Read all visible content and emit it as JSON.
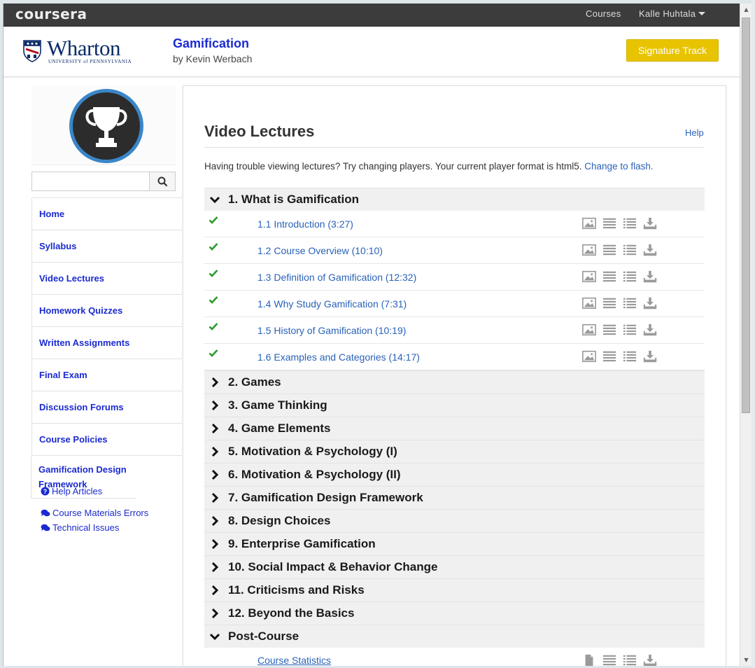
{
  "topbar": {
    "logo": "coursera",
    "courses_label": "Courses",
    "user_label": "Kalle Huhtala"
  },
  "header": {
    "school_name": "Wharton",
    "school_sub": "UNIVERSITY of PENNSYLVANIA",
    "course_title": "Gamification",
    "course_author": "by Kevin Werbach",
    "signature_track": "Signature Track"
  },
  "sidebar": {
    "search": {
      "value": "",
      "placeholder": ""
    },
    "items": [
      {
        "label": "Home"
      },
      {
        "label": "Syllabus"
      },
      {
        "label": "Video Lectures"
      },
      {
        "label": "Homework Quizzes"
      },
      {
        "label": "Written Assignments"
      },
      {
        "label": "Final Exam"
      },
      {
        "label": "Discussion Forums"
      },
      {
        "label": "Course Policies"
      },
      {
        "label": "Gamification Design Framework"
      }
    ],
    "help_links": [
      {
        "label": "Help Articles",
        "icon": "question-circle-icon"
      },
      {
        "label": "Course Materials Errors",
        "icon": "comments-icon"
      },
      {
        "label": "Technical Issues",
        "icon": "comments-icon"
      }
    ]
  },
  "main": {
    "title": "Video Lectures",
    "help_label": "Help",
    "notice_text": "Having trouble viewing lectures? Try changing players. Your current player format is html5.",
    "notice_link": "Change to flash.",
    "sections": [
      {
        "title": "1. What is Gamification",
        "expanded": true,
        "lectures": [
          {
            "title": "1.1 Introduction (3:27)",
            "watched": true
          },
          {
            "title": "1.2 Course Overview (10:10)",
            "watched": true
          },
          {
            "title": "1.3 Definition of Gamification (12:32)",
            "watched": true
          },
          {
            "title": "1.4 Why Study Gamification (7:31)",
            "watched": true
          },
          {
            "title": "1.5 History of Gamification (10:19)",
            "watched": true
          },
          {
            "title": "1.6 Examples and Categories (14:17)",
            "watched": true
          }
        ]
      },
      {
        "title": "2. Games",
        "expanded": false
      },
      {
        "title": "3. Game Thinking",
        "expanded": false
      },
      {
        "title": "4. Game Elements",
        "expanded": false
      },
      {
        "title": "5. Motivation & Psychology (I)",
        "expanded": false
      },
      {
        "title": "6. Motivation & Psychology (II)",
        "expanded": false
      },
      {
        "title": "7. Gamification Design Framework",
        "expanded": false
      },
      {
        "title": "8. Design Choices",
        "expanded": false
      },
      {
        "title": "9. Enterprise Gamification",
        "expanded": false
      },
      {
        "title": "10. Social Impact & Behavior Change",
        "expanded": false
      },
      {
        "title": "11. Criticisms and Risks",
        "expanded": false
      },
      {
        "title": "12. Beyond the Basics",
        "expanded": false
      },
      {
        "title": "Post-Course",
        "expanded": true,
        "lectures": [
          {
            "title": "Course Statistics",
            "watched": false,
            "underline": true,
            "first_icon": "document"
          }
        ]
      }
    ]
  },
  "colors": {
    "topbar_bg": "#3c3c3c",
    "link_blue": "#1a2ad0",
    "lecture_blue": "#2a62b8",
    "signature_yellow": "#e8c400",
    "check_green": "#2a9a2a"
  }
}
